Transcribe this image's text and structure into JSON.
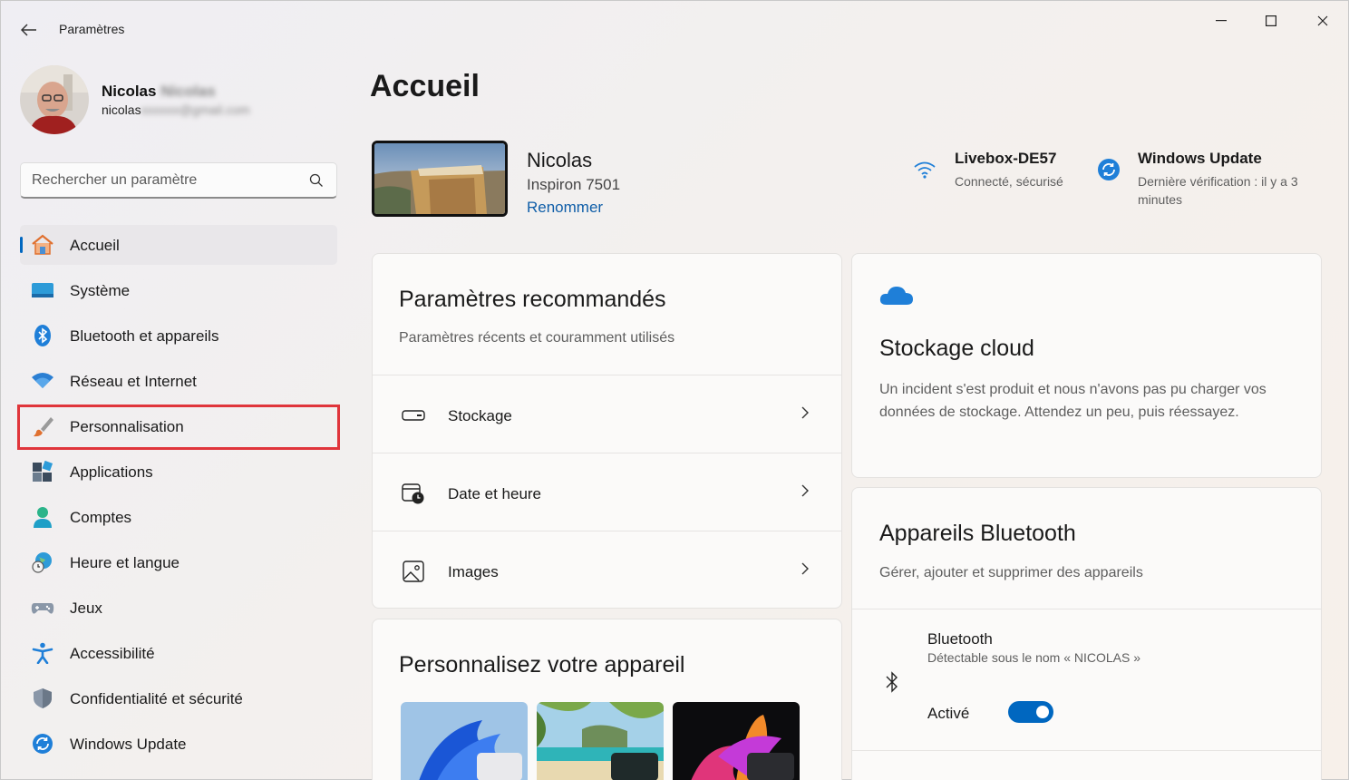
{
  "window": {
    "title": "Paramètres"
  },
  "user": {
    "name": "Nicolas",
    "name_hidden": "Nicolas",
    "email": "nicolas",
    "email_hidden": "nicolas@gmail.com"
  },
  "search": {
    "placeholder": "Rechercher un paramètre"
  },
  "sidebar": {
    "items": [
      {
        "label": "Accueil",
        "icon": "home-icon",
        "active": true
      },
      {
        "label": "Système",
        "icon": "system-icon"
      },
      {
        "label": "Bluetooth et appareils",
        "icon": "bluetooth-icon"
      },
      {
        "label": "Réseau et Internet",
        "icon": "wifi-icon"
      },
      {
        "label": "Personnalisation",
        "icon": "brush-icon",
        "highlighted": true
      },
      {
        "label": "Applications",
        "icon": "apps-icon"
      },
      {
        "label": "Comptes",
        "icon": "account-icon"
      },
      {
        "label": "Heure et langue",
        "icon": "time-language-icon"
      },
      {
        "label": "Jeux",
        "icon": "gamepad-icon"
      },
      {
        "label": "Accessibilité",
        "icon": "accessibility-icon"
      },
      {
        "label": "Confidentialité et sécurité",
        "icon": "shield-icon"
      },
      {
        "label": "Windows Update",
        "icon": "update-icon"
      }
    ]
  },
  "main": {
    "title": "Accueil",
    "device": {
      "name": "Nicolas",
      "model": "Inspiron 7501",
      "rename": "Renommer"
    },
    "network": {
      "name": "Livebox-DE57",
      "status": "Connecté, sécurisé"
    },
    "update": {
      "title": "Windows Update",
      "status": "Dernière vérification : il y a 3 minutes"
    },
    "recommended": {
      "title": "Paramètres recommandés",
      "subtitle": "Paramètres récents et couramment utilisés",
      "rows": [
        {
          "label": "Stockage",
          "icon": "storage-icon"
        },
        {
          "label": "Date et heure",
          "icon": "calendar-clock-icon"
        },
        {
          "label": "Images",
          "icon": "image-icon"
        }
      ]
    },
    "personalize": {
      "title": "Personnalisez votre appareil"
    },
    "cloud": {
      "title": "Stockage cloud",
      "message": "Un incident s'est produit et nous n'avons pas pu charger vos données de stockage. Attendez un peu, puis réessayez."
    },
    "bluetooth": {
      "title": "Appareils Bluetooth",
      "subtitle": "Gérer, ajouter et supprimer des appareils",
      "device_label": "Bluetooth",
      "device_sub": "Détectable sous le nom « NICOLAS »",
      "state": "Activé",
      "enabled": true
    }
  },
  "colors": {
    "accent": "#0067c0",
    "highlight_border": "#e0353b"
  }
}
